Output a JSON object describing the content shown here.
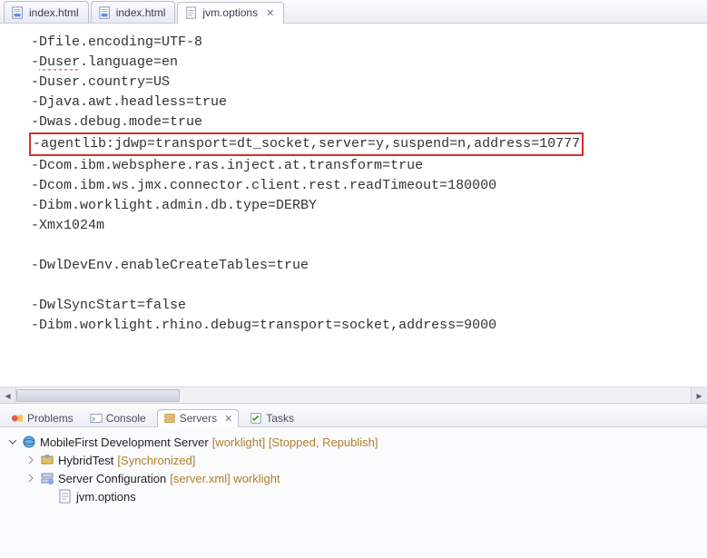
{
  "tabs": [
    {
      "label": "index.html",
      "kind": "html",
      "active": false
    },
    {
      "label": "index.html",
      "kind": "html",
      "active": false
    },
    {
      "label": "jvm.options",
      "kind": "txt",
      "active": true
    }
  ],
  "editor": {
    "lines": [
      "-Dfile.encoding=UTF-8",
      "-Duser.language=en",
      "-Duser.country=US",
      "-Djava.awt.headless=true",
      "-Dwas.debug.mode=true",
      "-agentlib:jdwp=transport=dt_socket,server=y,suspend=n,address=10777",
      "-Dcom.ibm.websphere.ras.inject.at.transform=true",
      "-Dcom.ibm.ws.jmx.connector.client.rest.readTimeout=180000",
      "-Dibm.worklight.admin.db.type=DERBY",
      "-Xmx1024m",
      "",
      "-DwlDevEnv.enableCreateTables=true",
      "",
      "-DwlSyncStart=false",
      "-Dibm.worklight.rhino.debug=transport=socket,address=9000"
    ],
    "highlighted_index": 5,
    "squiggle": {
      "line": 1,
      "text": "Duser"
    }
  },
  "view_tabs": [
    {
      "label": "Problems",
      "icon": "problems",
      "active": false
    },
    {
      "label": "Console",
      "icon": "console",
      "active": false
    },
    {
      "label": "Servers",
      "icon": "servers",
      "active": true
    },
    {
      "label": "Tasks",
      "icon": "tasks",
      "active": false
    }
  ],
  "servers_tree": {
    "root": {
      "label": "MobileFirst Development Server",
      "decor": "  [worklight]  [Stopped, Republish]",
      "icon": "server"
    },
    "children": [
      {
        "label": "HybridTest",
        "decor": "  [Synchronized]",
        "icon": "module",
        "expandable": true
      },
      {
        "label": "Server Configuration",
        "decor": " [server.xml] worklight",
        "icon": "config",
        "expandable": true
      },
      {
        "label": "jvm.options",
        "decor": "",
        "icon": "txt",
        "expandable": false,
        "indent": 2
      }
    ]
  }
}
